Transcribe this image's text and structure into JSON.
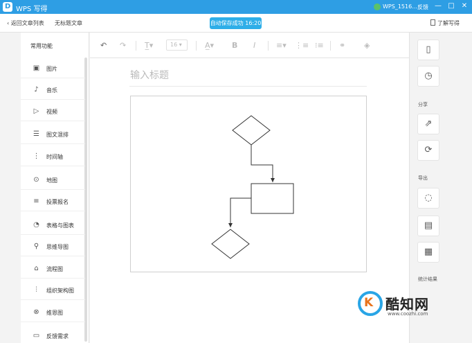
{
  "titlebar": {
    "app_name": "WPS 写得",
    "account": "WPS_1516...",
    "feedback": "反馈",
    "minimize": "—",
    "maximize": "□",
    "close": "✕"
  },
  "topnav": {
    "back": "返回文章列表",
    "untitled": "无标题文章",
    "autosave": "自动保存成功 16:20",
    "learn": "了解写得"
  },
  "sidebar": {
    "title": "常用功能",
    "items": [
      {
        "label": "图片",
        "icon": "image-icon"
      },
      {
        "label": "音乐",
        "icon": "music-icon"
      },
      {
        "label": "视频",
        "icon": "video-icon"
      },
      {
        "label": "图文混排",
        "icon": "layout-icon"
      },
      {
        "label": "时间轴",
        "icon": "timeline-icon"
      },
      {
        "label": "地图",
        "icon": "map-pin-icon"
      },
      {
        "label": "投票报名",
        "icon": "vote-icon"
      },
      {
        "label": "表格与图表",
        "icon": "chart-icon"
      },
      {
        "label": "思维导图",
        "icon": "mindmap-icon"
      },
      {
        "label": "流程图",
        "icon": "flowchart-icon"
      },
      {
        "label": "组织架构图",
        "icon": "org-chart-icon"
      },
      {
        "label": "维恩图",
        "icon": "venn-icon"
      },
      {
        "label": "反馈需求",
        "icon": "feedback-icon"
      }
    ]
  },
  "toolbar": {
    "font_size": "16"
  },
  "editor": {
    "title_placeholder": "输入标题"
  },
  "rightpanel": {
    "share": "分享",
    "export": "导出",
    "stats": "统计结果"
  },
  "watermark": {
    "brand": "酷知网",
    "url": "www.coozhi.com",
    "logo_letter": "K"
  },
  "colors": {
    "accent": "#2e9ee4",
    "autosave_bg": "#2eaee8"
  }
}
